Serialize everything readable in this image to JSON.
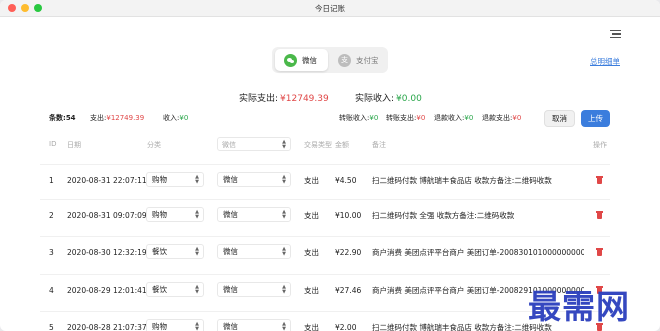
{
  "window": {
    "title": "今日记账"
  },
  "header": {
    "summary_link": "总明细单"
  },
  "tabs": [
    {
      "label": "微信",
      "icon": "wechat-icon",
      "active": true
    },
    {
      "label": "支付宝",
      "icon": "alipay-icon",
      "icon_char": "支",
      "active": false
    }
  ],
  "totals": {
    "expense_label": "实际支出:",
    "expense_value": "¥12749.39",
    "income_label": "实际收入:",
    "income_value": "¥0.00"
  },
  "stats": {
    "count_label": "条数:",
    "count_value": "54",
    "expense_label": "支出:",
    "expense_value": "¥12749.39",
    "income_label": "收入:",
    "income_value": "¥0",
    "transfer_in_label": "转账收入:",
    "transfer_in_value": "¥0",
    "transfer_out_label": "转账支出:",
    "transfer_out_value": "¥0",
    "refund_in_label": "退款收入:",
    "refund_in_value": "¥0",
    "refund_out_label": "退款支出:",
    "refund_out_value": "¥0"
  },
  "actions": {
    "cancel": "取消",
    "upload": "上传"
  },
  "columns": {
    "id": "ID",
    "date": "日期",
    "category": "分类",
    "channel": "微信",
    "type": "交易类型",
    "amount": "金额",
    "note": "备注",
    "action": "操作"
  },
  "rows": [
    {
      "id": "1",
      "date": "2020-08-31 22:07:11",
      "category": "购物",
      "channel": "微信",
      "type": "支出",
      "amount": "¥4.50",
      "note": "扫二维码付款 博航瑞丰食品店 收款方备注:二维码收款"
    },
    {
      "id": "2",
      "date": "2020-08-31 09:07:09",
      "category": "购物",
      "channel": "微信",
      "type": "支出",
      "amount": "¥10.00",
      "note": "扫二维码付款 全强 收款方备注:二维码收款"
    },
    {
      "id": "3",
      "date": "2020-08-30 12:32:19",
      "category": "餐饮",
      "channel": "微信",
      "type": "支出",
      "amount": "¥22.90",
      "note": "商户消费 美团点评平台商户 美团订单-20083010100000000004..."
    },
    {
      "id": "4",
      "date": "2020-08-29 12:01:41",
      "category": "餐饮",
      "channel": "微信",
      "type": "支出",
      "amount": "¥27.46",
      "note": "商户消费 美团点评平台商户 美团订单-20082910100000000004..."
    },
    {
      "id": "5",
      "date": "2020-08-28 21:07:37",
      "category": "购物",
      "channel": "微信",
      "type": "支出",
      "amount": "¥2.00",
      "note": "扫二维码付款 博航瑞丰食品店 收款方备注:二维码收款"
    }
  ],
  "watermark": "最需网",
  "colors": {
    "accent": "#3b7ddd",
    "expense": "#e04747",
    "income": "#29a64a"
  }
}
